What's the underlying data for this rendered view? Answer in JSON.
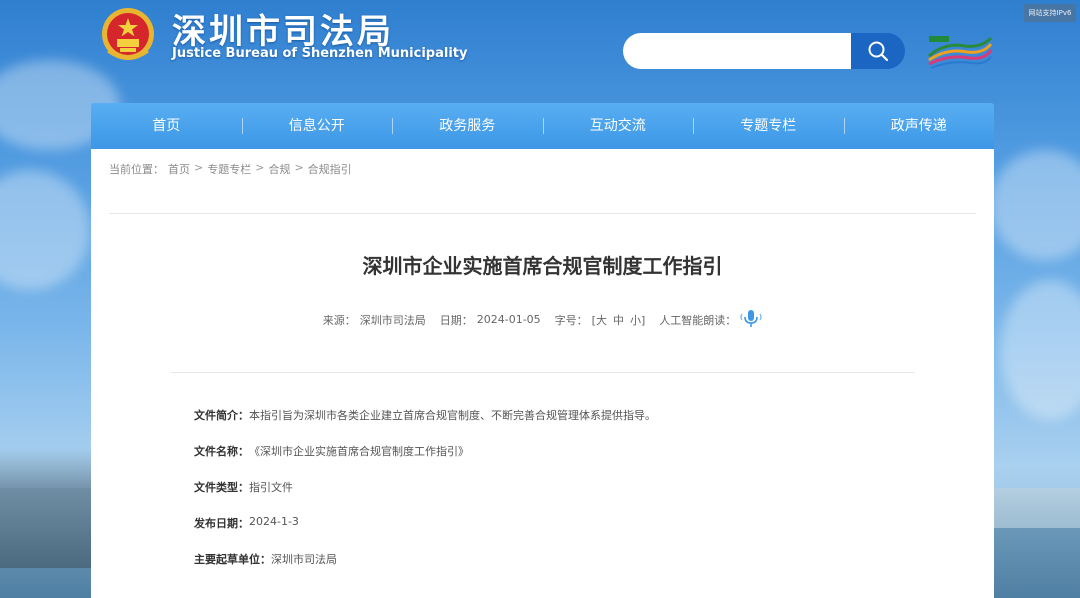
{
  "corner": {
    "text": "网站支持IPv6"
  },
  "header": {
    "title_cn": "深圳市司法局",
    "title_en": "Justice Bureau of Shenzhen Municipality",
    "search": {
      "placeholder": "",
      "value": ""
    }
  },
  "nav": {
    "items": [
      "首页",
      "信息公开",
      "政务服务",
      "互动交流",
      "专题专栏",
      "政声传递"
    ]
  },
  "breadcrumb": {
    "prefix": "当前位置：",
    "items": [
      "首页",
      "专题专栏",
      "合规",
      "合规指引"
    ],
    "separator": ">"
  },
  "article": {
    "title": "深圳市企业实施首席合规官制度工作指引",
    "meta": {
      "source_label": "来源：",
      "source_value": "深圳市司法局",
      "date_label": "日期：",
      "date_value": "2024-01-05",
      "fontsize_label": "字号：",
      "fontsize_options": [
        "[大",
        "中",
        "小]"
      ],
      "ai_read_label": "人工智能朗读："
    },
    "info": [
      {
        "label": "文件简介：",
        "value": "本指引旨为深圳市各类企业建立首席合规官制度、不断完善合规管理体系提供指导。"
      },
      {
        "label": "文件名称：",
        "value": "《深圳市企业实施首席合规官制度工作指引》"
      },
      {
        "label": "文件类型：",
        "value": "指引文件"
      },
      {
        "label": "发布日期：",
        "value": "2024-1-3"
      },
      {
        "label": "主要起草单位：",
        "value": "深圳市司法局"
      }
    ]
  },
  "colors": {
    "nav_bg": "#3d97e6",
    "search_button": "#1a66c2",
    "emblem_red": "#d4262b",
    "emblem_gold": "#e8b530"
  },
  "icons": {
    "search": "search-icon",
    "emblem": "national-emblem-icon",
    "speaker": "speaker-icon"
  }
}
